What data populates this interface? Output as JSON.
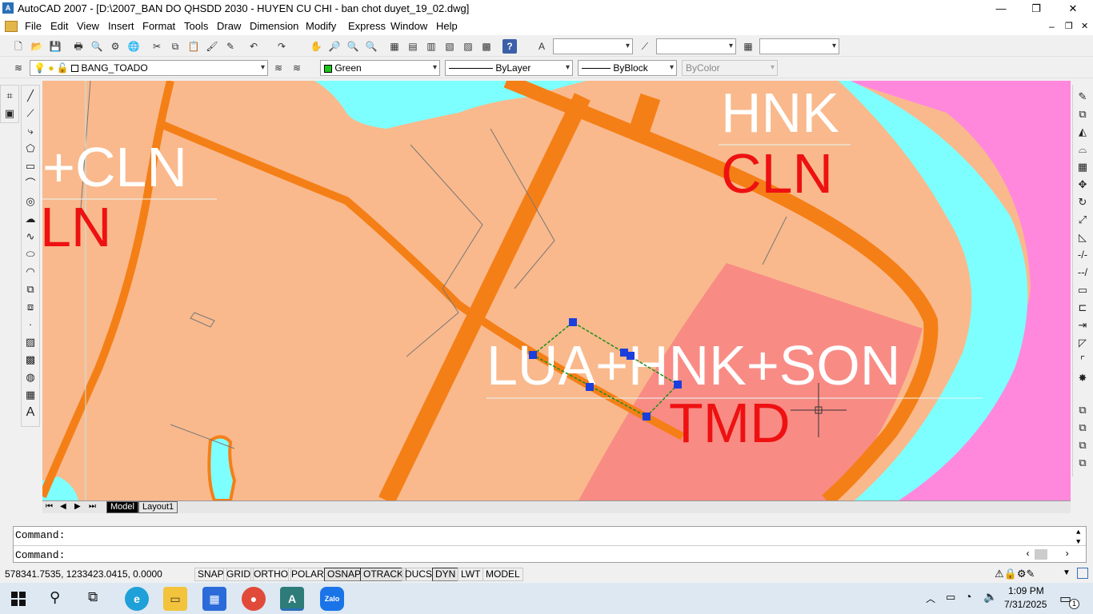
{
  "window": {
    "title": "AutoCAD 2007 - [D:\\2007_BAN DO QHSDD 2030 - HUYEN CU CHI - ban chot duyet_19_02.dwg]",
    "minimize": "—",
    "restore": "❐",
    "close": "✕"
  },
  "menu": {
    "items": [
      "File",
      "Edit",
      "View",
      "Insert",
      "Format",
      "Tools",
      "Draw",
      "Dimension",
      "Modify",
      "Express",
      "Window",
      "Help"
    ],
    "doc_min": "–",
    "doc_restore": "❐",
    "doc_close": "✕"
  },
  "layers_toolbar": {
    "layer_name": "BANG_TOADO",
    "color": "Green",
    "color_swatch": "#19c619",
    "linetype": "ByLayer",
    "lineweight": "ByBlock",
    "plotstyle": "ByColor"
  },
  "drawing": {
    "labels": {
      "cln_plus": "+CLN",
      "ln": "LN",
      "hnk": "HNK",
      "cln": "CLN",
      "lua_hnk_son": "LUA+HNK+SON",
      "tmd": "TMD"
    },
    "colors": {
      "background": "#f9b98c",
      "road": "#f57f17",
      "water": "#7dffff",
      "pink_zone": "#ff88dd",
      "commercial": "#f98b85",
      "label_white": "#ffffff",
      "label_red": "#ee1111",
      "grip": "#1a3fdd"
    }
  },
  "tabs": {
    "model": "Model",
    "layout1": "Layout1"
  },
  "command": {
    "line1": "Command:",
    "line2": "Command:"
  },
  "status": {
    "coords": "578341.7535, 1233423.0415, 0.0000",
    "buttons": [
      "SNAP",
      "GRID",
      "ORTHO",
      "POLAR",
      "OSNAP",
      "OTRACK",
      "DUCS",
      "DYN",
      "LWT",
      "MODEL"
    ]
  },
  "taskbar": {
    "time": "1:09 PM",
    "date": "7/31/2025",
    "notification_count": "1",
    "apps": [
      "start-icon",
      "search-icon",
      "task-view-icon",
      "edge-icon",
      "file-explorer-icon",
      "store-icon",
      "chrome-icon",
      "autocad-icon",
      "zalo-icon"
    ],
    "zalo_label": "Zalo"
  }
}
